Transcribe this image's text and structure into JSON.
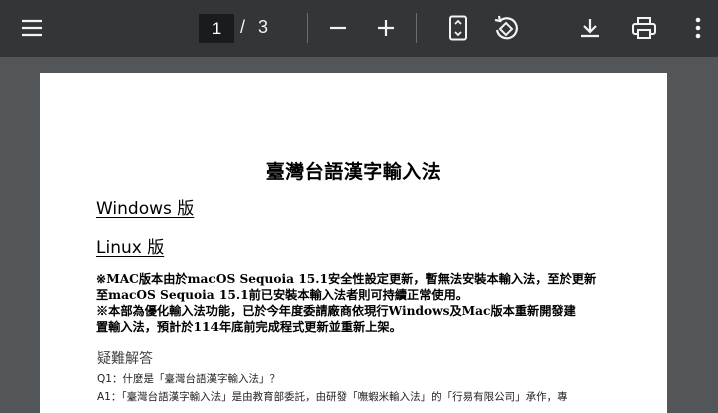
{
  "toolbar": {
    "menu_icon": "hamburger-menu-icon",
    "page_current": "1",
    "page_separator": "/",
    "page_total": "3",
    "zoom_out_icon": "minus-icon",
    "zoom_in_icon": "plus-icon",
    "fit_icon": "fit-to-page-icon",
    "rotate_icon": "rotate-counterclockwise-icon",
    "download_icon": "download-icon",
    "print_icon": "print-icon",
    "more_icon": "more-vertical-icon"
  },
  "document": {
    "title": "臺灣台語漢字輸入法",
    "links": [
      "Windows 版",
      "Linux 版"
    ],
    "notice_lines": [
      "※MAC版本由於macOS Sequoia 15.1安全性設定更新，暫無法安裝本輸入法，至於更新",
      "至macOS Sequoia 15.1前已安裝本輸入法者則可持續正常使用。",
      "※本部為優化輸入法功能，已於今年度委請廠商依現行Windows及Mac版本重新開發建",
      "置輸入法，預計於114年底前完成程式更新並重新上架。"
    ],
    "faq_title": "疑難解答",
    "q1": "Q1：什麼是「臺灣台語漢字輸入法」？",
    "a1": "A1：「臺灣台語漢字輸入法」是由教育部委託，由研發「嘸蝦米輸入法」的「行易有限公司」承作，專"
  },
  "colors": {
    "toolbar_bg": "#323639",
    "viewer_bg": "#525659",
    "page_bg": "#ffffff",
    "icon_color": "#f1f3f4"
  }
}
